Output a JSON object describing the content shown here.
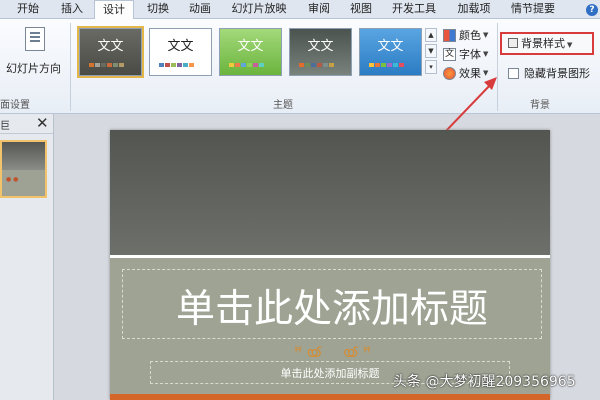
{
  "tabs": [
    "开始",
    "插入",
    "设计",
    "切换",
    "动画",
    "幻灯片放映",
    "审阅",
    "视图",
    "开发工具",
    "加载项",
    "情节提要"
  ],
  "active_tab": "设计",
  "ribbon": {
    "page_setup": {
      "slide_orientation": "幻灯片方向",
      "group_label": "面设置"
    },
    "themes": {
      "group_label": "主题",
      "items": [
        {
          "label": "文文",
          "bg": "#5e5e58",
          "text_color": "#ffffff",
          "selected": true
        },
        {
          "label": "文文",
          "bg": "#ffffff",
          "text_color": "#222222",
          "selected": false
        },
        {
          "label": "文文",
          "bg": "#8fcf5a",
          "text_color": "#ffffff",
          "selected": false
        },
        {
          "label": "文文",
          "bg": "#4f5a57",
          "text_color": "#ffffff",
          "selected": false
        },
        {
          "label": "文文",
          "bg": "#3e8fd3",
          "text_color": "#ffffff",
          "selected": false
        }
      ]
    },
    "colors_label": "颜色",
    "fonts_label": "字体",
    "effects_label": "效果",
    "background": {
      "group_label": "背景",
      "style_label": "背景样式",
      "hide_graphics_label": "隐藏背景图形"
    }
  },
  "slide_pane": {
    "tab_label": "巨"
  },
  "slide": {
    "title": "单击此处添加标题",
    "subtitle": "单击此处添加副标题"
  },
  "watermark": "头条 @大梦初醒209356965",
  "colors": {
    "accent": "#d83b3b",
    "slide_band": "#9ea393",
    "slide_top": "#5d605b"
  }
}
